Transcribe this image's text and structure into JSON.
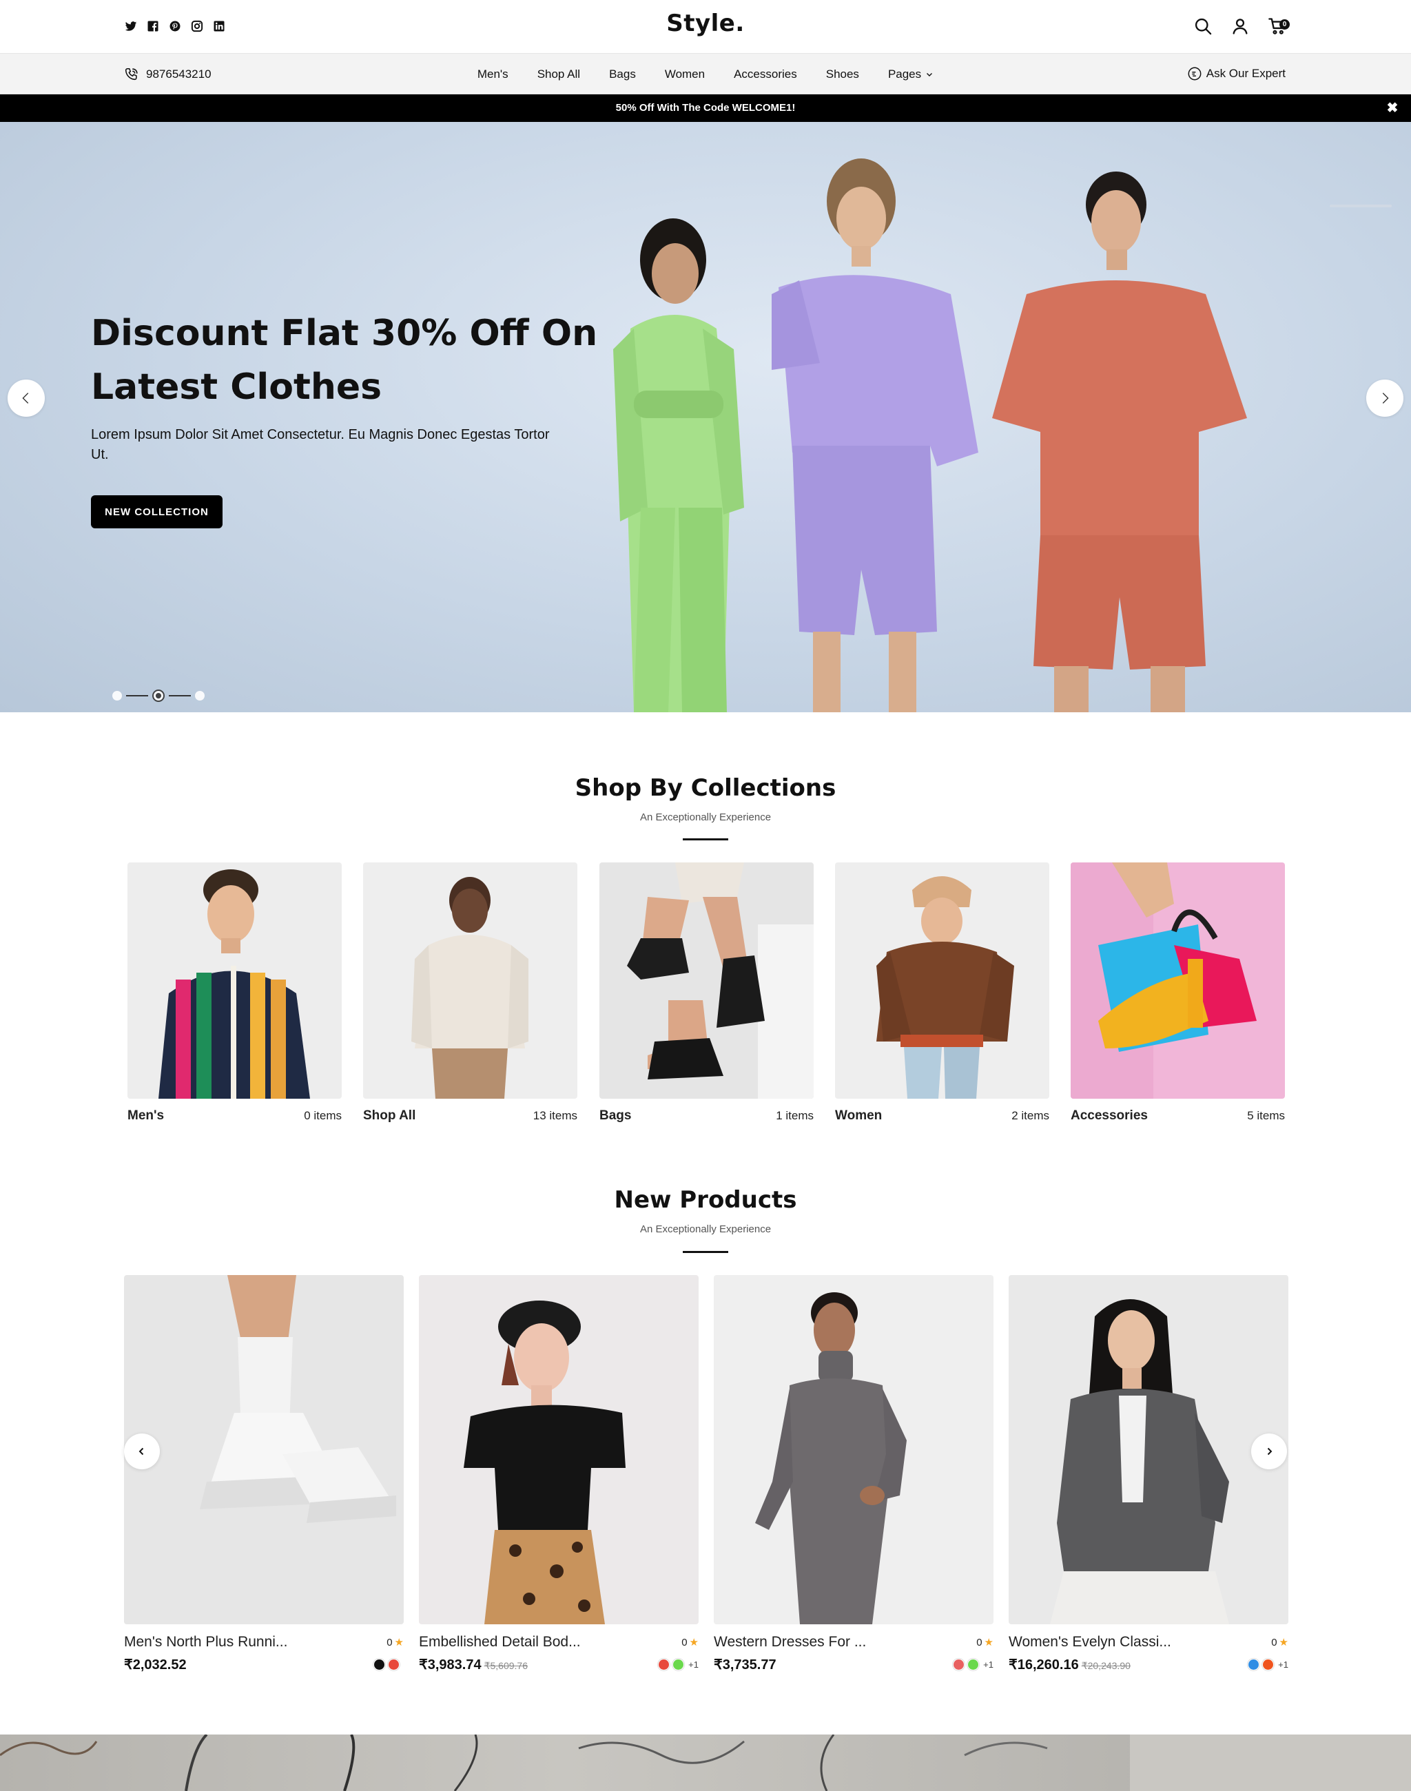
{
  "header": {
    "logo": "Style.",
    "socials": [
      "twitter-icon",
      "facebook-icon",
      "pinterest-icon",
      "instagram-icon",
      "linkedin-icon"
    ],
    "actions": [
      "search-icon",
      "user-icon",
      "cart-icon"
    ],
    "cart_count": "0"
  },
  "nav": {
    "phone": "9876543210",
    "items": [
      {
        "label": "Men's"
      },
      {
        "label": "Shop All"
      },
      {
        "label": "Bags"
      },
      {
        "label": "Women"
      },
      {
        "label": "Accessories"
      },
      {
        "label": "Shoes"
      },
      {
        "label": "Pages"
      }
    ],
    "expert": "Ask Our Expert"
  },
  "announcement": {
    "text": "50% Off With The Code WELCOME1!",
    "close": "✖"
  },
  "hero": {
    "title": "Discount Flat 30% Off On Latest Clothes",
    "subtitle": "Lorem Ipsum Dolor Sit Amet Consectetur. Eu Magnis Donec Egestas Tortor Ut.",
    "button": "NEW COLLECTION",
    "slides": 3,
    "active_slide": 2
  },
  "collections": {
    "title": "Shop By Collections",
    "subtitle": "An Exceptionally Experience",
    "items": [
      {
        "name": "Men's",
        "count": "0 items"
      },
      {
        "name": "Shop All",
        "count": "13 items"
      },
      {
        "name": "Bags",
        "count": "1 items"
      },
      {
        "name": "Women",
        "count": "2 items"
      },
      {
        "name": "Accessories",
        "count": "5 items"
      }
    ]
  },
  "products": {
    "title": "New Products",
    "subtitle": "An Exceptionally Experience",
    "items": [
      {
        "name": "Men's North Plus Runni...",
        "rating": "0",
        "price": "₹2,032.52",
        "old_price": "",
        "swatches": [
          "#111111",
          "#e8483b"
        ],
        "more": ""
      },
      {
        "name": "Embellished Detail Bod...",
        "rating": "0",
        "price": "₹3,983.74",
        "old_price": "₹5,609.76",
        "swatches": [
          "#e8483b",
          "#6ad84c"
        ],
        "more": "+1"
      },
      {
        "name": "Western Dresses For ...",
        "rating": "0",
        "price": "₹3,735.77",
        "old_price": "",
        "swatches": [
          "#e86060",
          "#6ad84c"
        ],
        "more": "+1"
      },
      {
        "name": "Women's Evelyn Classi...",
        "rating": "0",
        "price": "₹16,260.16",
        "old_price": "₹20,243.90",
        "swatches": [
          "#2f8de4",
          "#f0541e"
        ],
        "more": "+1"
      }
    ]
  }
}
